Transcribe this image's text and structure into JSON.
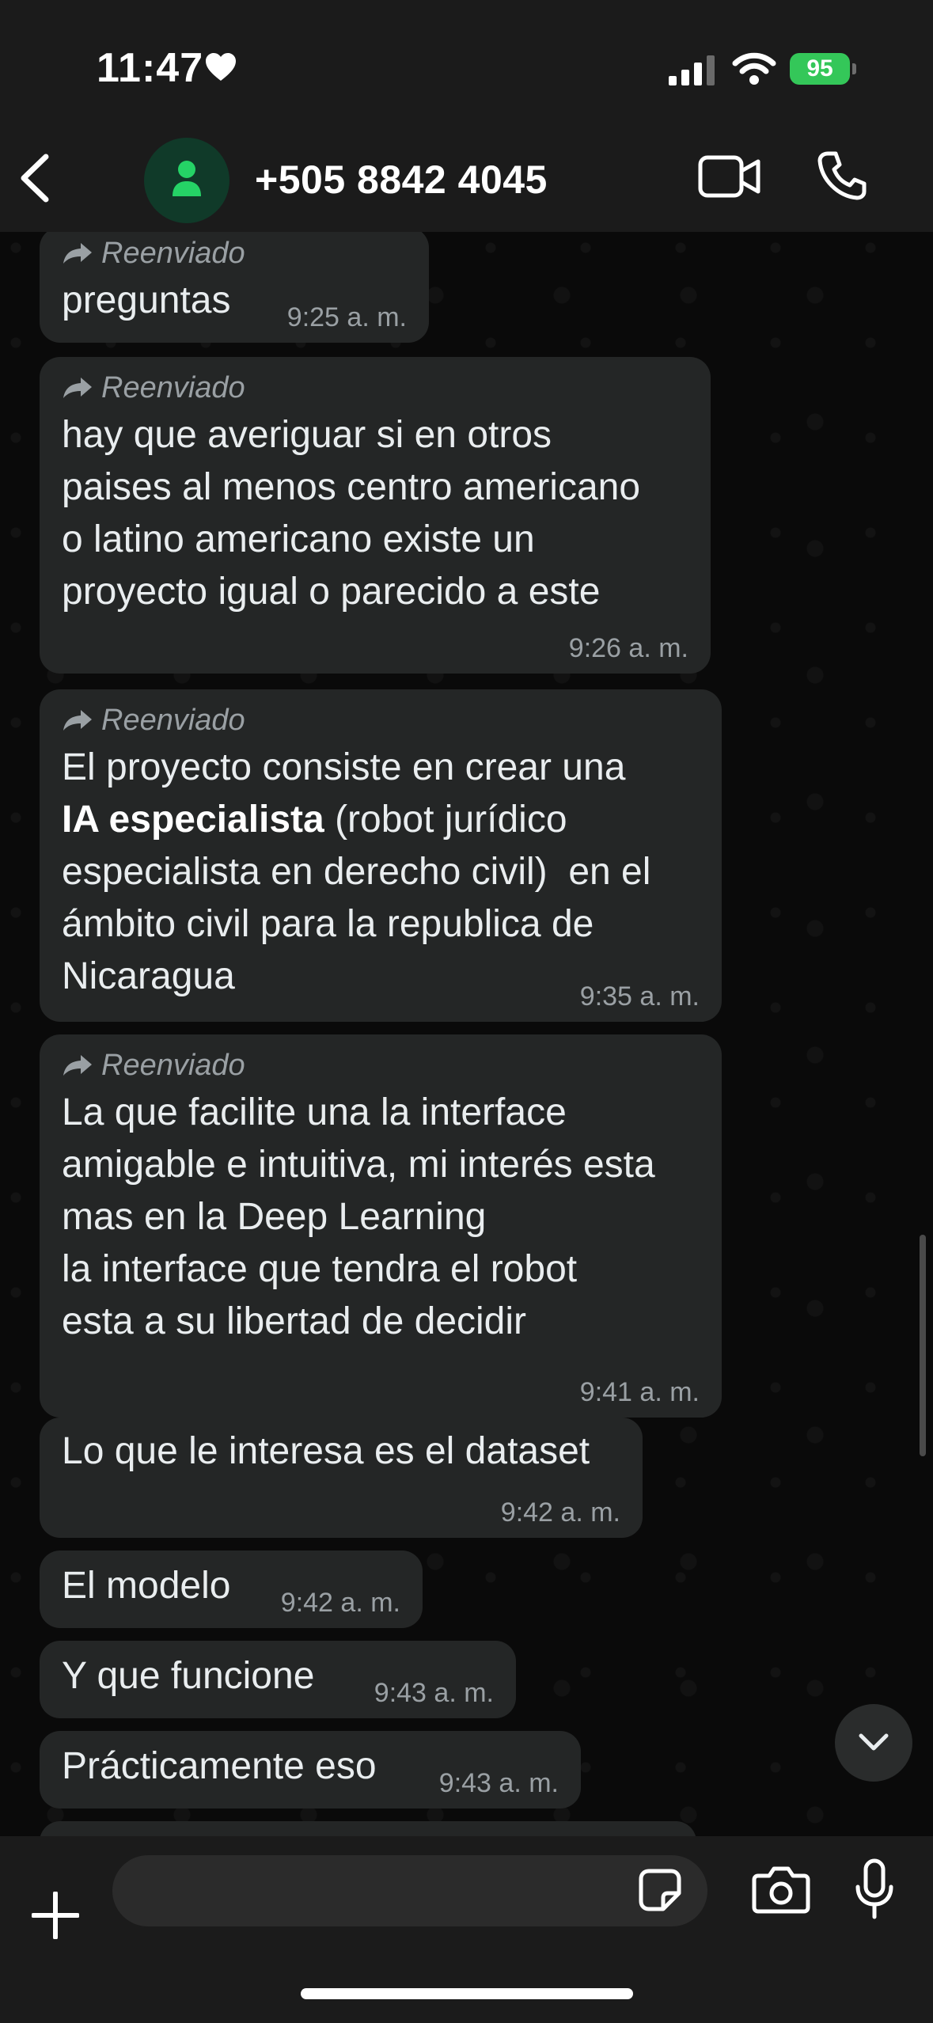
{
  "status_bar": {
    "time": "11:47",
    "battery": "95"
  },
  "header": {
    "contact": "+505 8842 4045"
  },
  "chat": {
    "forwarded_label": "Reenviado",
    "messages": [
      {
        "text": "preguntas",
        "time": "9:25 a. m."
      },
      {
        "text": "hay que averiguar si en otros\npaises al menos centro americano\no latino americano existe un\nproyecto igual o parecido a este",
        "time": "9:26 a. m."
      },
      {
        "text_before": "El proyecto consiste en crear una\n",
        "text_bold": "IA especialista",
        "text_after": " (robot jurídico\nespecialista en derecho civil)  en el\námbito civil para la republica de\nNicaragua",
        "time": "9:35 a. m."
      },
      {
        "text": "La que facilite una la interface\namigable e intuitiva, mi interés esta\nmas en la Deep Learning\nla interface que tendra el robot\nesta a su libertad de decidir",
        "time": "9:41 a. m."
      },
      {
        "text": "Lo que le interesa es el dataset",
        "time": "9:42 a. m."
      },
      {
        "text": "El modelo",
        "time": "9:42 a. m."
      },
      {
        "text": "Y que funcione",
        "time": "9:43 a. m."
      },
      {
        "text": "Prácticamente eso",
        "time": "9:43 a. m."
      }
    ]
  },
  "composer": {
    "placeholder": ""
  },
  "icons": {
    "status": [
      "heart-icon",
      "signal-icon",
      "wifi-icon",
      "battery-icon"
    ],
    "header": [
      "back-icon",
      "contact-avatar-icon",
      "video-call-icon",
      "voice-call-icon"
    ],
    "forwarded": "forward-arrow-icon",
    "composer": [
      "plus-icon",
      "sticker-icon",
      "camera-icon",
      "microphone-icon"
    ],
    "scroll": "chevron-down-icon"
  },
  "colors": {
    "bubble": "#242626",
    "accent": "#25d366",
    "battery": "#34c759",
    "background": "#0a0a0a"
  }
}
